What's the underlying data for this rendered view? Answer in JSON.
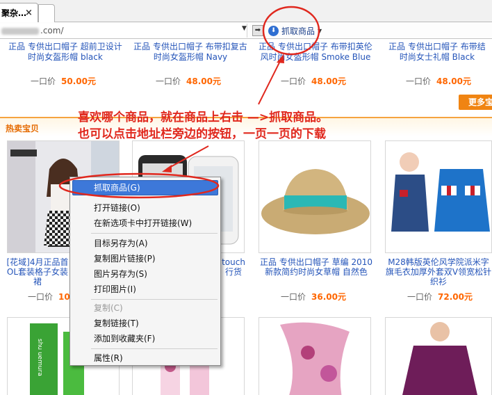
{
  "browser": {
    "tab_title": "聚杂…",
    "tab_close": "×",
    "address_visible": ".com/",
    "go_arrow": "➡",
    "grab_button_label": "抓取商品",
    "grab_icon": "arrow-down-circle-icon"
  },
  "top_products": [
    {
      "title": "正品 专供出口帽子 超前卫设计 时尚女盔形帽 black",
      "price_label": "一口价",
      "price": "50.00元"
    },
    {
      "title": "正品 专供出口帽子 布带扣复古时尚女盔形帽 Navy",
      "price_label": "一口价",
      "price": "48.00元"
    },
    {
      "title": "正品 专供出口帽子 布带扣英伦风时尚女盔形帽 Smoke Blue",
      "price_label": "一口价",
      "price": "48.00元"
    },
    {
      "title": "正品 专供出口帽子 布带结 时尚女士礼帽 Black",
      "price_label": "一口价",
      "price": "48.00元"
    }
  ],
  "more_button": "更多宝",
  "section_title": "热卖宝贝",
  "annotation": {
    "line1": "喜欢哪个商品，就在商品上右击 —>抓取商品。",
    "line2": "也可以点击地址栏旁边的按钮，一页一页的下载"
  },
  "row2_products": [
    {
      "title": "[花域]4月正品首OL套装格子女装裙",
      "price_label": "一口价",
      "price": "10"
    },
    {
      "title": "touch 行货",
      "price_label": "",
      "price": ""
    },
    {
      "title": "正品 专供出口帽子 草编 2010新款简约时尚女草帽 自然色",
      "price_label": "一口价",
      "price": "36.00元"
    },
    {
      "title": "M28韩版英伦风学院派米字旗毛衣加厚外套双V领宽松针织衫",
      "price_label": "一口价",
      "price": "72.00元"
    }
  ],
  "context_menu": [
    {
      "label": "抓取商品(G)",
      "highlighted": true
    },
    {
      "label": "打开链接(O)"
    },
    {
      "label": "在新选项卡中打开链接(W)"
    },
    {
      "label": "目标另存为(A)"
    },
    {
      "label": "复制图片链接(P)"
    },
    {
      "label": "图片另存为(S)"
    },
    {
      "label": "打印图片(I)"
    },
    {
      "label": "复制(C)",
      "disabled": true
    },
    {
      "label": "复制链接(T)"
    },
    {
      "label": "添加到收藏夹(F)"
    },
    {
      "label": "属性(R)"
    }
  ],
  "thumb_brand_text": "shu uemura",
  "colors": {
    "link": "#2454b9",
    "price": "#ff6600",
    "annotation": "#e0281e",
    "menu_highlight": "#3d78d9"
  }
}
